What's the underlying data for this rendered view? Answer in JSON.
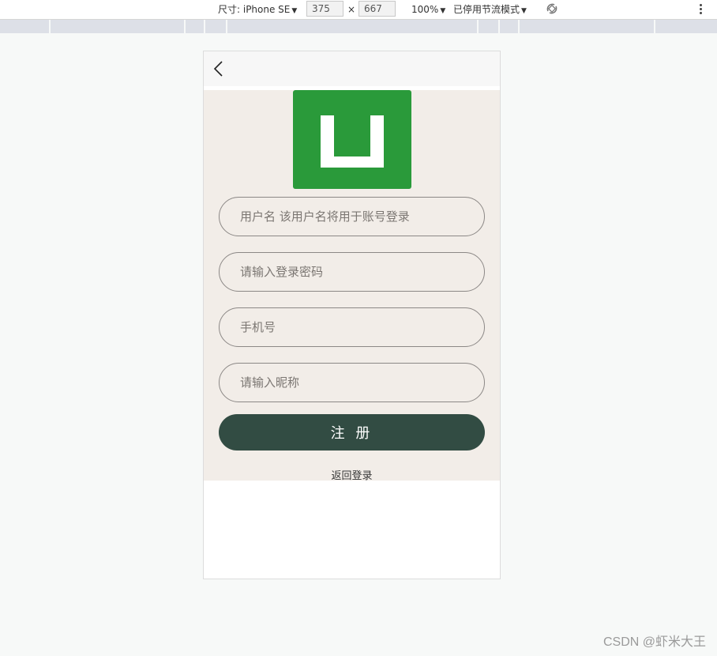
{
  "devtools": {
    "device_label": "尺寸: iPhone SE",
    "width": "375",
    "times": "×",
    "height": "667",
    "zoom": "100%",
    "throttle": "已停用节流模式"
  },
  "form": {
    "username_placeholder": "用户名 该用户名将用于账号登录",
    "password_placeholder": "请输入登录密码",
    "phone_placeholder": "手机号",
    "nickname_placeholder": "请输入昵称",
    "submit_label": "注 册",
    "back_login": "返回登录"
  },
  "logo": {
    "color": "#2a9a3a"
  },
  "watermark": "CSDN @虾米大王",
  "colors": {
    "button": "#324c43",
    "page_bg": "#f2ede8"
  }
}
